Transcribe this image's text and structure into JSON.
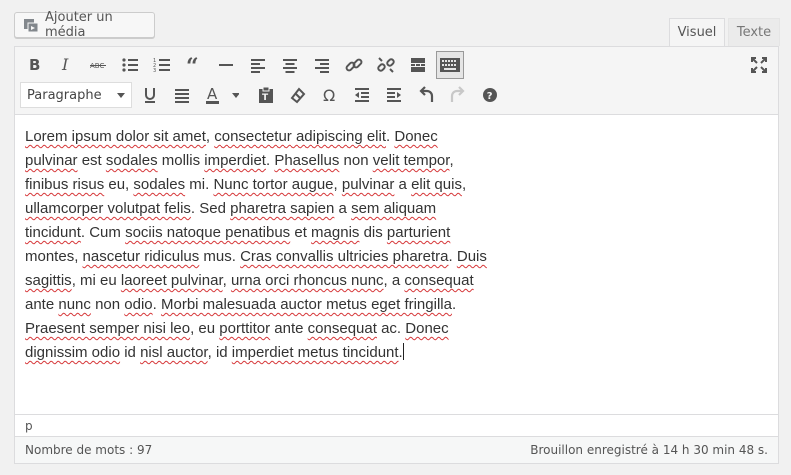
{
  "media_button": {
    "label": "Ajouter un média",
    "icon": "media-icon"
  },
  "tabs": {
    "visual": "Visuel",
    "text": "Texte"
  },
  "toolbar": {
    "row1": [
      {
        "name": "bold-button",
        "icon": "bold-icon",
        "title": "Gras"
      },
      {
        "name": "italic-button",
        "icon": "italic-icon",
        "title": "Italique"
      },
      {
        "name": "strikethrough-button",
        "icon": "strikethrough-icon",
        "title": "Barré"
      },
      {
        "name": "bullet-list-button",
        "icon": "bullet-list-icon",
        "title": "Liste non numérotée"
      },
      {
        "name": "numbered-list-button",
        "icon": "numbered-list-icon",
        "title": "Liste numérotée"
      },
      {
        "name": "blockquote-button",
        "icon": "quote-icon",
        "title": "Citation"
      },
      {
        "name": "horizontal-line-button",
        "icon": "horizontal-line-icon",
        "title": "Ligne horizontale"
      },
      {
        "name": "align-left-button",
        "icon": "align-left-icon",
        "title": "Aligner à gauche"
      },
      {
        "name": "align-center-button",
        "icon": "align-center-icon",
        "title": "Centrer"
      },
      {
        "name": "align-right-button",
        "icon": "align-right-icon",
        "title": "Aligner à droite"
      },
      {
        "name": "insert-link-button",
        "icon": "link-icon",
        "title": "Insérer un lien"
      },
      {
        "name": "remove-link-button",
        "icon": "unlink-icon",
        "title": "Retirer le lien"
      },
      {
        "name": "read-more-button",
        "icon": "read-more-icon",
        "title": "Insérer la balise Lire la suite"
      },
      {
        "name": "toolbar-toggle-button",
        "icon": "keyboard-icon",
        "title": "Barre d'outils",
        "active": true
      }
    ],
    "fullscreen": {
      "name": "distraction-free-button",
      "icon": "fullscreen-icon"
    },
    "format_select": {
      "value": "Paragraphe"
    },
    "row2": [
      {
        "name": "underline-button",
        "icon": "underline-icon"
      },
      {
        "name": "justify-button",
        "icon": "justify-icon"
      },
      {
        "name": "text-color-button",
        "icon": "text-color-icon"
      },
      {
        "name": "paste-text-button",
        "icon": "paste-text-icon"
      },
      {
        "name": "clear-formatting-button",
        "icon": "eraser-icon"
      },
      {
        "name": "special-character-button",
        "icon": "omega-icon"
      },
      {
        "name": "outdent-button",
        "icon": "outdent-icon"
      },
      {
        "name": "indent-button",
        "icon": "indent-icon"
      },
      {
        "name": "undo-button",
        "icon": "undo-icon"
      },
      {
        "name": "redo-button",
        "icon": "redo-icon",
        "disabled": true
      },
      {
        "name": "help-button",
        "icon": "help-icon"
      }
    ],
    "text_color": "#555555"
  },
  "content": {
    "lines": [
      [
        {
          "t": "Lorem ipsum dolor sit amet",
          "s": true
        },
        {
          "t": ", "
        },
        {
          "t": "consectetur adipiscing elit",
          "s": true
        },
        {
          "t": ". "
        },
        {
          "t": "Donec",
          "s": true
        }
      ],
      [
        {
          "t": "pulvinar",
          "s": true
        },
        {
          "t": " est "
        },
        {
          "t": "sodales",
          "s": true
        },
        {
          "t": " mollis "
        },
        {
          "t": "imperdiet",
          "s": true
        },
        {
          "t": ". "
        },
        {
          "t": "Phasellus",
          "s": true
        },
        {
          "t": " non "
        },
        {
          "t": "velit tempor",
          "s": true
        },
        {
          "t": ","
        }
      ],
      [
        {
          "t": "finibus risus",
          "s": true
        },
        {
          "t": " eu, "
        },
        {
          "t": "sodales",
          "s": true
        },
        {
          "t": " mi. "
        },
        {
          "t": "Nunc tortor augue",
          "s": true
        },
        {
          "t": ", "
        },
        {
          "t": "pulvinar",
          "s": true
        },
        {
          "t": " a "
        },
        {
          "t": "elit quis",
          "s": true
        },
        {
          "t": ","
        }
      ],
      [
        {
          "t": "ullamcorper volutpat felis",
          "s": true
        },
        {
          "t": ". Sed "
        },
        {
          "t": "pharetra sapien",
          "s": true
        },
        {
          "t": " a "
        },
        {
          "t": "sem aliquam",
          "s": true
        }
      ],
      [
        {
          "t": "tincidunt",
          "s": true
        },
        {
          "t": ". Cum "
        },
        {
          "t": "sociis natoque penatibus",
          "s": true
        },
        {
          "t": " et "
        },
        {
          "t": "magnis",
          "s": true
        },
        {
          "t": " dis "
        },
        {
          "t": "parturient",
          "s": true
        }
      ],
      [
        {
          "t": "montes, "
        },
        {
          "t": "nascetur ridiculus",
          "s": true
        },
        {
          "t": " mus. "
        },
        {
          "t": "Cras convallis ultricies pharetra",
          "s": true
        },
        {
          "t": ". "
        },
        {
          "t": "Duis",
          "s": true
        }
      ],
      [
        {
          "t": "sagittis",
          "s": true
        },
        {
          "t": ", mi eu "
        },
        {
          "t": "laoreet pulvinar",
          "s": true
        },
        {
          "t": ", "
        },
        {
          "t": "urna orci rhoncus nunc",
          "s": true
        },
        {
          "t": ", a "
        },
        {
          "t": "consequat",
          "s": true
        }
      ],
      [
        {
          "t": "ante "
        },
        {
          "t": "nunc",
          "s": true
        },
        {
          "t": " non "
        },
        {
          "t": "odio",
          "s": true
        },
        {
          "t": ". "
        },
        {
          "t": "Morbi malesuada auctor metus eget fringilla",
          "s": true
        },
        {
          "t": "."
        }
      ],
      [
        {
          "t": "Praesent semper nisi leo",
          "s": true
        },
        {
          "t": ", eu "
        },
        {
          "t": "porttitor",
          "s": true
        },
        {
          "t": " ante "
        },
        {
          "t": "consequat",
          "s": true
        },
        {
          "t": " ac. "
        },
        {
          "t": "Donec",
          "s": true
        }
      ],
      [
        {
          "t": "dignissim odio",
          "s": true
        },
        {
          "t": " id "
        },
        {
          "t": "nisl auctor",
          "s": true
        },
        {
          "t": ", id "
        },
        {
          "t": "imperdiet metus tincidunt",
          "s": true
        },
        {
          "t": "."
        }
      ]
    ]
  },
  "path": "p",
  "status": {
    "word_count": "Nombre de mots : 97",
    "saved": "Brouillon enregistré à 14 h 30 min 48 s."
  }
}
